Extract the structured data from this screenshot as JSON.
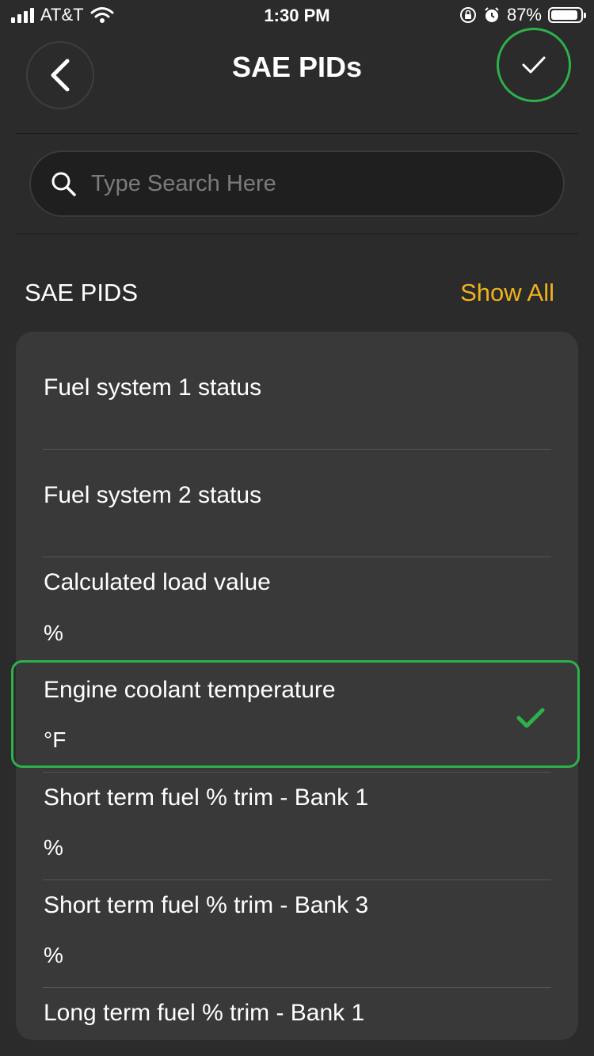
{
  "status_bar": {
    "carrier": "AT&T",
    "time": "1:30 PM",
    "battery": "87%",
    "battery_level": 0.87,
    "icons": [
      "signal-icon",
      "wifi-icon",
      "orientation-lock-icon",
      "alarm-icon",
      "battery-icon"
    ]
  },
  "header": {
    "title": "SAE PIDs",
    "back_icon": "chevron-left-icon",
    "confirm_icon": "checkmark-icon"
  },
  "search": {
    "placeholder": "Type Search Here",
    "value": ""
  },
  "section": {
    "title": "SAE PIDS",
    "show_all": "Show All"
  },
  "items": [
    {
      "name": "Fuel system 1 status",
      "unit": "",
      "selected": false
    },
    {
      "name": "Fuel system 2 status",
      "unit": "",
      "selected": false
    },
    {
      "name": "Calculated load value",
      "unit": "%",
      "selected": false
    },
    {
      "name": "Engine coolant temperature",
      "unit": "°F",
      "selected": true
    },
    {
      "name": "Short term fuel % trim - Bank 1",
      "unit": "%",
      "selected": false
    },
    {
      "name": "Short term fuel % trim - Bank 3",
      "unit": "%",
      "selected": false
    },
    {
      "name": "Long term fuel % trim - Bank 1",
      "unit": "",
      "selected": false
    }
  ],
  "colors": {
    "accent": "#f0b21c",
    "selected": "#2db14a",
    "background": "#2b2b2b",
    "card": "#393939"
  }
}
